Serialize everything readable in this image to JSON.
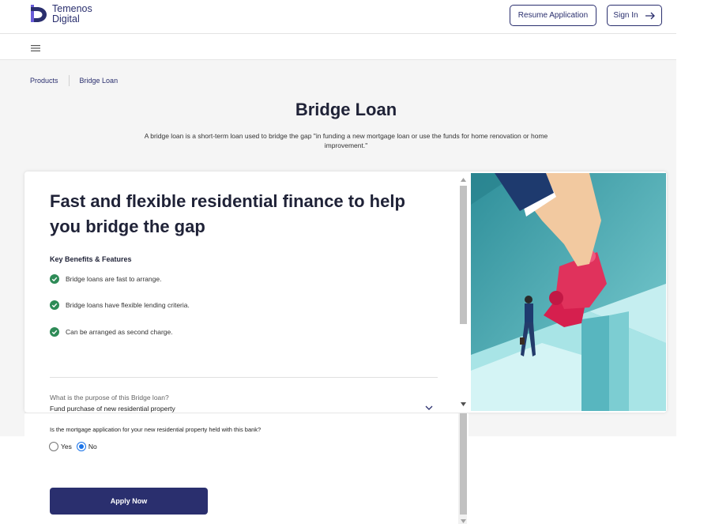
{
  "brand": {
    "line1": "Temenos",
    "line2": "Digital",
    "primary_color": "#2a2f6e"
  },
  "header": {
    "resume_label": "Resume Application",
    "signin_label": "Sign In"
  },
  "breadcrumb": {
    "items": [
      "Products",
      "Bridge Loan"
    ]
  },
  "page": {
    "title": "Bridge Loan",
    "description": "A bridge loan is a short-term loan used to bridge the gap \"in funding a new mortgage loan or use the funds for home renovation or home improvement.\""
  },
  "card": {
    "title": "Fast and flexible residential finance to help you bridge the gap",
    "benefits_heading": "Key Benefits & Features",
    "benefits": [
      "Bridge loans are fast to arrange.",
      "Bridge loans have flexible lending criteria.",
      "Can be arranged as second charge."
    ],
    "check_color": "#2e8b57"
  },
  "form": {
    "purpose_label": "What is the purpose of this Bridge loan?",
    "purpose_value": "Fund purchase of new residential property",
    "mortgage_question": "Is the mortgage application for your new residential property held with this bank?",
    "options": [
      "Yes",
      "No"
    ],
    "selected": "No",
    "apply_label": "Apply Now"
  }
}
